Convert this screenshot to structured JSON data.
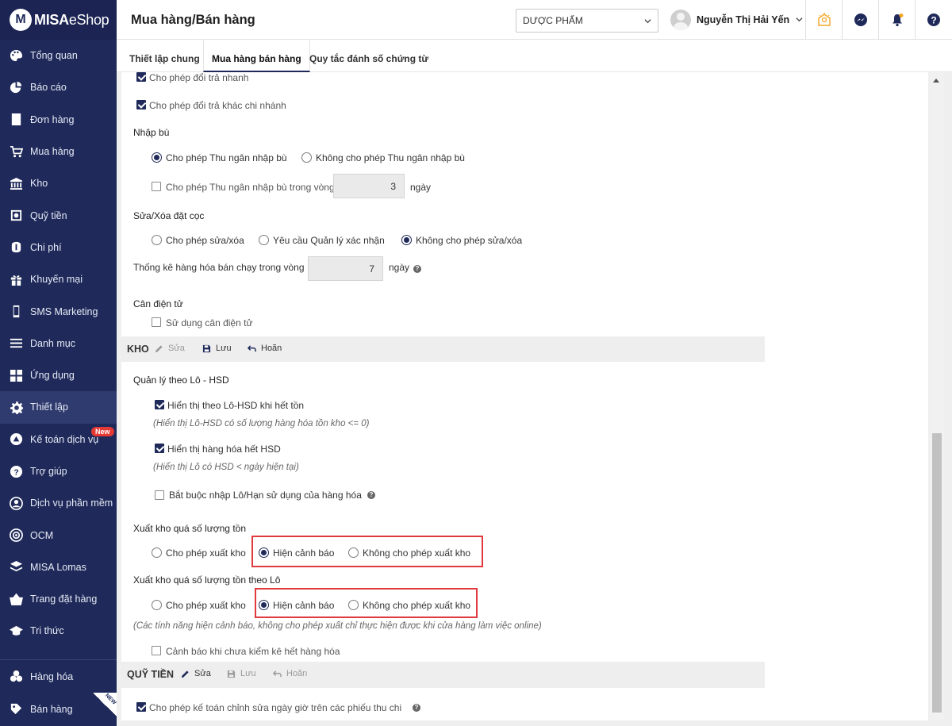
{
  "app": {
    "logo_mark": "M",
    "logo_bold": "MISA",
    "logo_thin": "eShop"
  },
  "header": {
    "title": "Mua hàng/Bán hàng",
    "store": "DƯỢC PHẨM",
    "user_name": "Nguyễn Thị Hải Yến"
  },
  "sidebar": {
    "items": [
      {
        "label": "Tổng quan",
        "icon": "palette-icon"
      },
      {
        "label": "Báo cáo",
        "icon": "pie-chart-icon"
      },
      {
        "label": "Đơn hàng",
        "icon": "order-icon"
      },
      {
        "label": "Mua hàng",
        "icon": "cart-icon"
      },
      {
        "label": "Kho",
        "icon": "warehouse-icon"
      },
      {
        "label": "Quỹ tiền",
        "icon": "safe-icon"
      },
      {
        "label": "Chi phí",
        "icon": "money-icon"
      },
      {
        "label": "Khuyến mại",
        "icon": "gift-icon"
      },
      {
        "label": "SMS Marketing",
        "icon": "phone-icon"
      },
      {
        "label": "Danh mục",
        "icon": "list-icon"
      },
      {
        "label": "Ứng dụng",
        "icon": "apps-icon"
      },
      {
        "label": "Thiết lập",
        "icon": "gear-icon"
      },
      {
        "label": "Kế toán dịch vụ",
        "icon": "accounting-icon",
        "badge": "New"
      },
      {
        "label": "Trợ giúp",
        "icon": "help-icon"
      },
      {
        "label": "Dịch vụ phần mềm",
        "icon": "user-icon"
      },
      {
        "label": "OCM",
        "icon": "ocm-icon"
      },
      {
        "label": "MISA Lomas",
        "icon": "layers-icon"
      },
      {
        "label": "Trang đặt hàng",
        "icon": "basket-icon"
      },
      {
        "label": "Tri thức",
        "icon": "graduation-icon"
      }
    ],
    "bottom": [
      {
        "label": "Hàng hóa",
        "icon": "goods-icon"
      },
      {
        "label": "Bán hàng",
        "icon": "sales-icon",
        "corner": "NEW"
      }
    ]
  },
  "tabs": [
    "Thiết lập chung",
    "Mua hàng bán hàng",
    "Quy tắc đánh số chứng từ"
  ],
  "content": {
    "top_cb1": "Cho phép đổi trả nhanh",
    "top_cb2": "Cho phép đổi trả khác chi nhánh",
    "nhap_bu_title": "Nhập bù",
    "nhap_bu_opt1": "Cho phép Thu ngân nhập bù",
    "nhap_bu_opt2": "Không cho phép Thu ngân nhập bù",
    "nhap_bu_cb": "Cho phép Thu ngân nhập bù trong vòng",
    "nhap_bu_days": "3",
    "unit_days": "ngày",
    "sua_xoa_title": "Sửa/Xóa đặt cọc",
    "sua_xoa_opt1": "Cho phép sửa/xóa",
    "sua_xoa_opt2": "Yêu cầu Quản lý xác nhận",
    "sua_xoa_opt3": "Không cho phép sửa/xóa",
    "thong_ke_label": "Thống kê hàng hóa bán chạy trong vòng",
    "thong_ke_days": "7",
    "can_title": "Cân điện tử",
    "can_cb": "Sử dụng cân điện tử",
    "kho_bar": {
      "title": "KHO",
      "edit": "Sửa",
      "save": "Lưu",
      "cancel": "Hoãn"
    },
    "lo_title": "Quản lý theo Lô - HSD",
    "lo_cb1": "Hiển thị theo Lô-HSD khi hết tồn",
    "lo_note1": "(Hiển thị Lô-HSD có số lượng hàng hóa tồn kho <= 0)",
    "lo_cb2": "Hiển thị hàng hóa hết HSD",
    "lo_note2": "(Hiển thị Lô có HSD < ngày hiện tại)",
    "lo_cb3": "Bắt buộc nhập Lô/Hạn sử dụng của hàng hóa",
    "xk_title": "Xuất kho quá số lượng tồn",
    "xk_opt1": "Cho phép xuất kho",
    "xk_opt2": "Hiện cảnh báo",
    "xk_opt3": "Không cho phép xuất kho",
    "xklo_title": "Xuất kho quá số lượng tồn theo Lô",
    "xklo_opt1": "Cho phép xuất kho",
    "xklo_opt2": "Hiện cảnh báo",
    "xklo_opt3": "Không cho phép xuất kho",
    "xk_note": "(Các tính năng hiện cảnh báo, không cho phép xuất chỉ thực hiện được khi cửa hàng làm việc online)",
    "kiemke_cb": "Cảnh báo khi chưa kiểm kê hết hàng hóa",
    "quy_bar": {
      "title": "QUỸ TIỀN",
      "edit": "Sửa",
      "save": "Lưu",
      "cancel": "Hoãn"
    },
    "quy_cb": "Cho phép kế toán chỉnh sửa ngày giờ trên các phiếu thu chi"
  },
  "colors": {
    "sidebar": "#1f2a5a",
    "accent": "#1f2a5a",
    "highlight_box": "#e0393e",
    "new_badge": "#e53935"
  }
}
